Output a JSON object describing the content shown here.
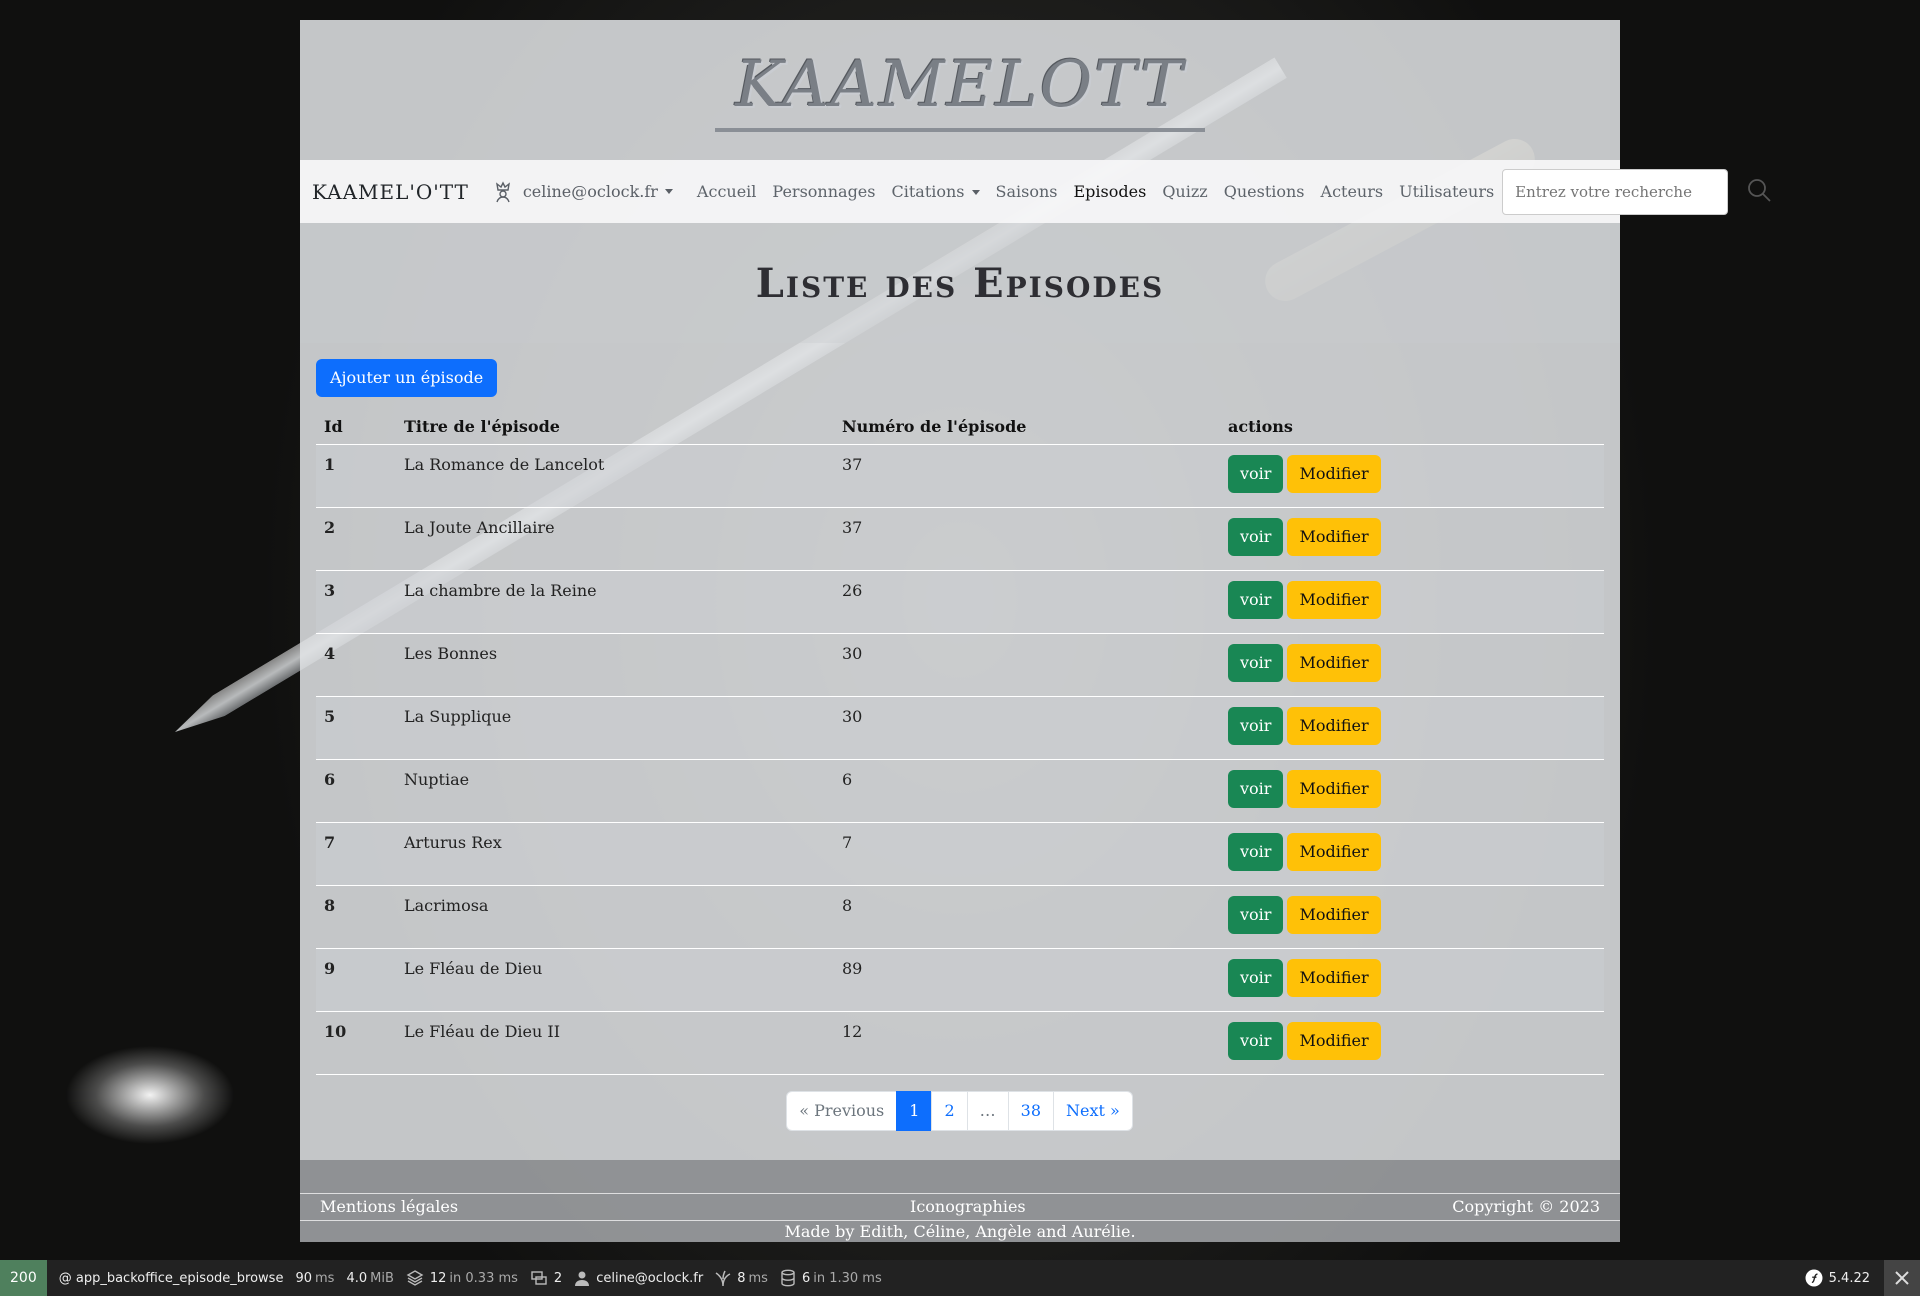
{
  "logo_text": "KAAMELOTT",
  "navbar": {
    "brand": "KAAMEL'O'TT",
    "user": "celine@oclock.fr",
    "items": [
      "Accueil",
      "Personnages",
      "Citations",
      "Saisons",
      "Episodes",
      "Quizz",
      "Questions",
      "Acteurs",
      "Utilisateurs"
    ],
    "active": "Episodes",
    "search_placeholder": "Entrez votre recherche"
  },
  "page_title": "Liste des Episodes",
  "add_button": "Ajouter un épisode",
  "table": {
    "headers": [
      "Id",
      "Titre de l'épisode",
      "Numéro de l'épisode",
      "actions"
    ],
    "rows": [
      {
        "id": "1",
        "title": "La Romance de Lancelot",
        "number": "37"
      },
      {
        "id": "2",
        "title": "La Joute Ancillaire",
        "number": "37"
      },
      {
        "id": "3",
        "title": "La chambre de la Reine",
        "number": "26"
      },
      {
        "id": "4",
        "title": "Les Bonnes",
        "number": "30"
      },
      {
        "id": "5",
        "title": "La Supplique",
        "number": "30"
      },
      {
        "id": "6",
        "title": "Nuptiae",
        "number": "6"
      },
      {
        "id": "7",
        "title": "Arturus Rex",
        "number": "7"
      },
      {
        "id": "8",
        "title": "Lacrimosa",
        "number": "8"
      },
      {
        "id": "9",
        "title": "Le Fléau de Dieu",
        "number": "89"
      },
      {
        "id": "10",
        "title": "Le Fléau de Dieu II",
        "number": "12"
      }
    ],
    "view_label": "voir",
    "edit_label": "Modifier"
  },
  "pagination": {
    "previous": "« Previous",
    "pages": [
      "1",
      "2",
      "…",
      "38"
    ],
    "current": "1",
    "next": "Next »"
  },
  "footer": {
    "left": "Mentions légales",
    "middle": "Iconographies",
    "right": "Copyright © 2023",
    "made_by": "Made by Edith, Céline, Angèle and Aurélie."
  },
  "debug_toolbar": {
    "status": "200",
    "route": "@ app_backoffice_episode_browse",
    "time_value": "90",
    "time_unit": "ms",
    "memory_value": "4.0",
    "memory_unit": "MiB",
    "cache_count": "12",
    "cache_time": "in 0.33 ms",
    "forms_count": "2",
    "user": "celine@oclock.fr",
    "twig_time": "8",
    "twig_unit": "ms",
    "db_count": "6",
    "db_time": "in 1.30 ms",
    "symfony_version": "5.4.22"
  },
  "colors": {
    "primary": "#0d6efd",
    "success": "#198754",
    "warning": "#ffc107",
    "toolbar_status": "#4f805d"
  }
}
